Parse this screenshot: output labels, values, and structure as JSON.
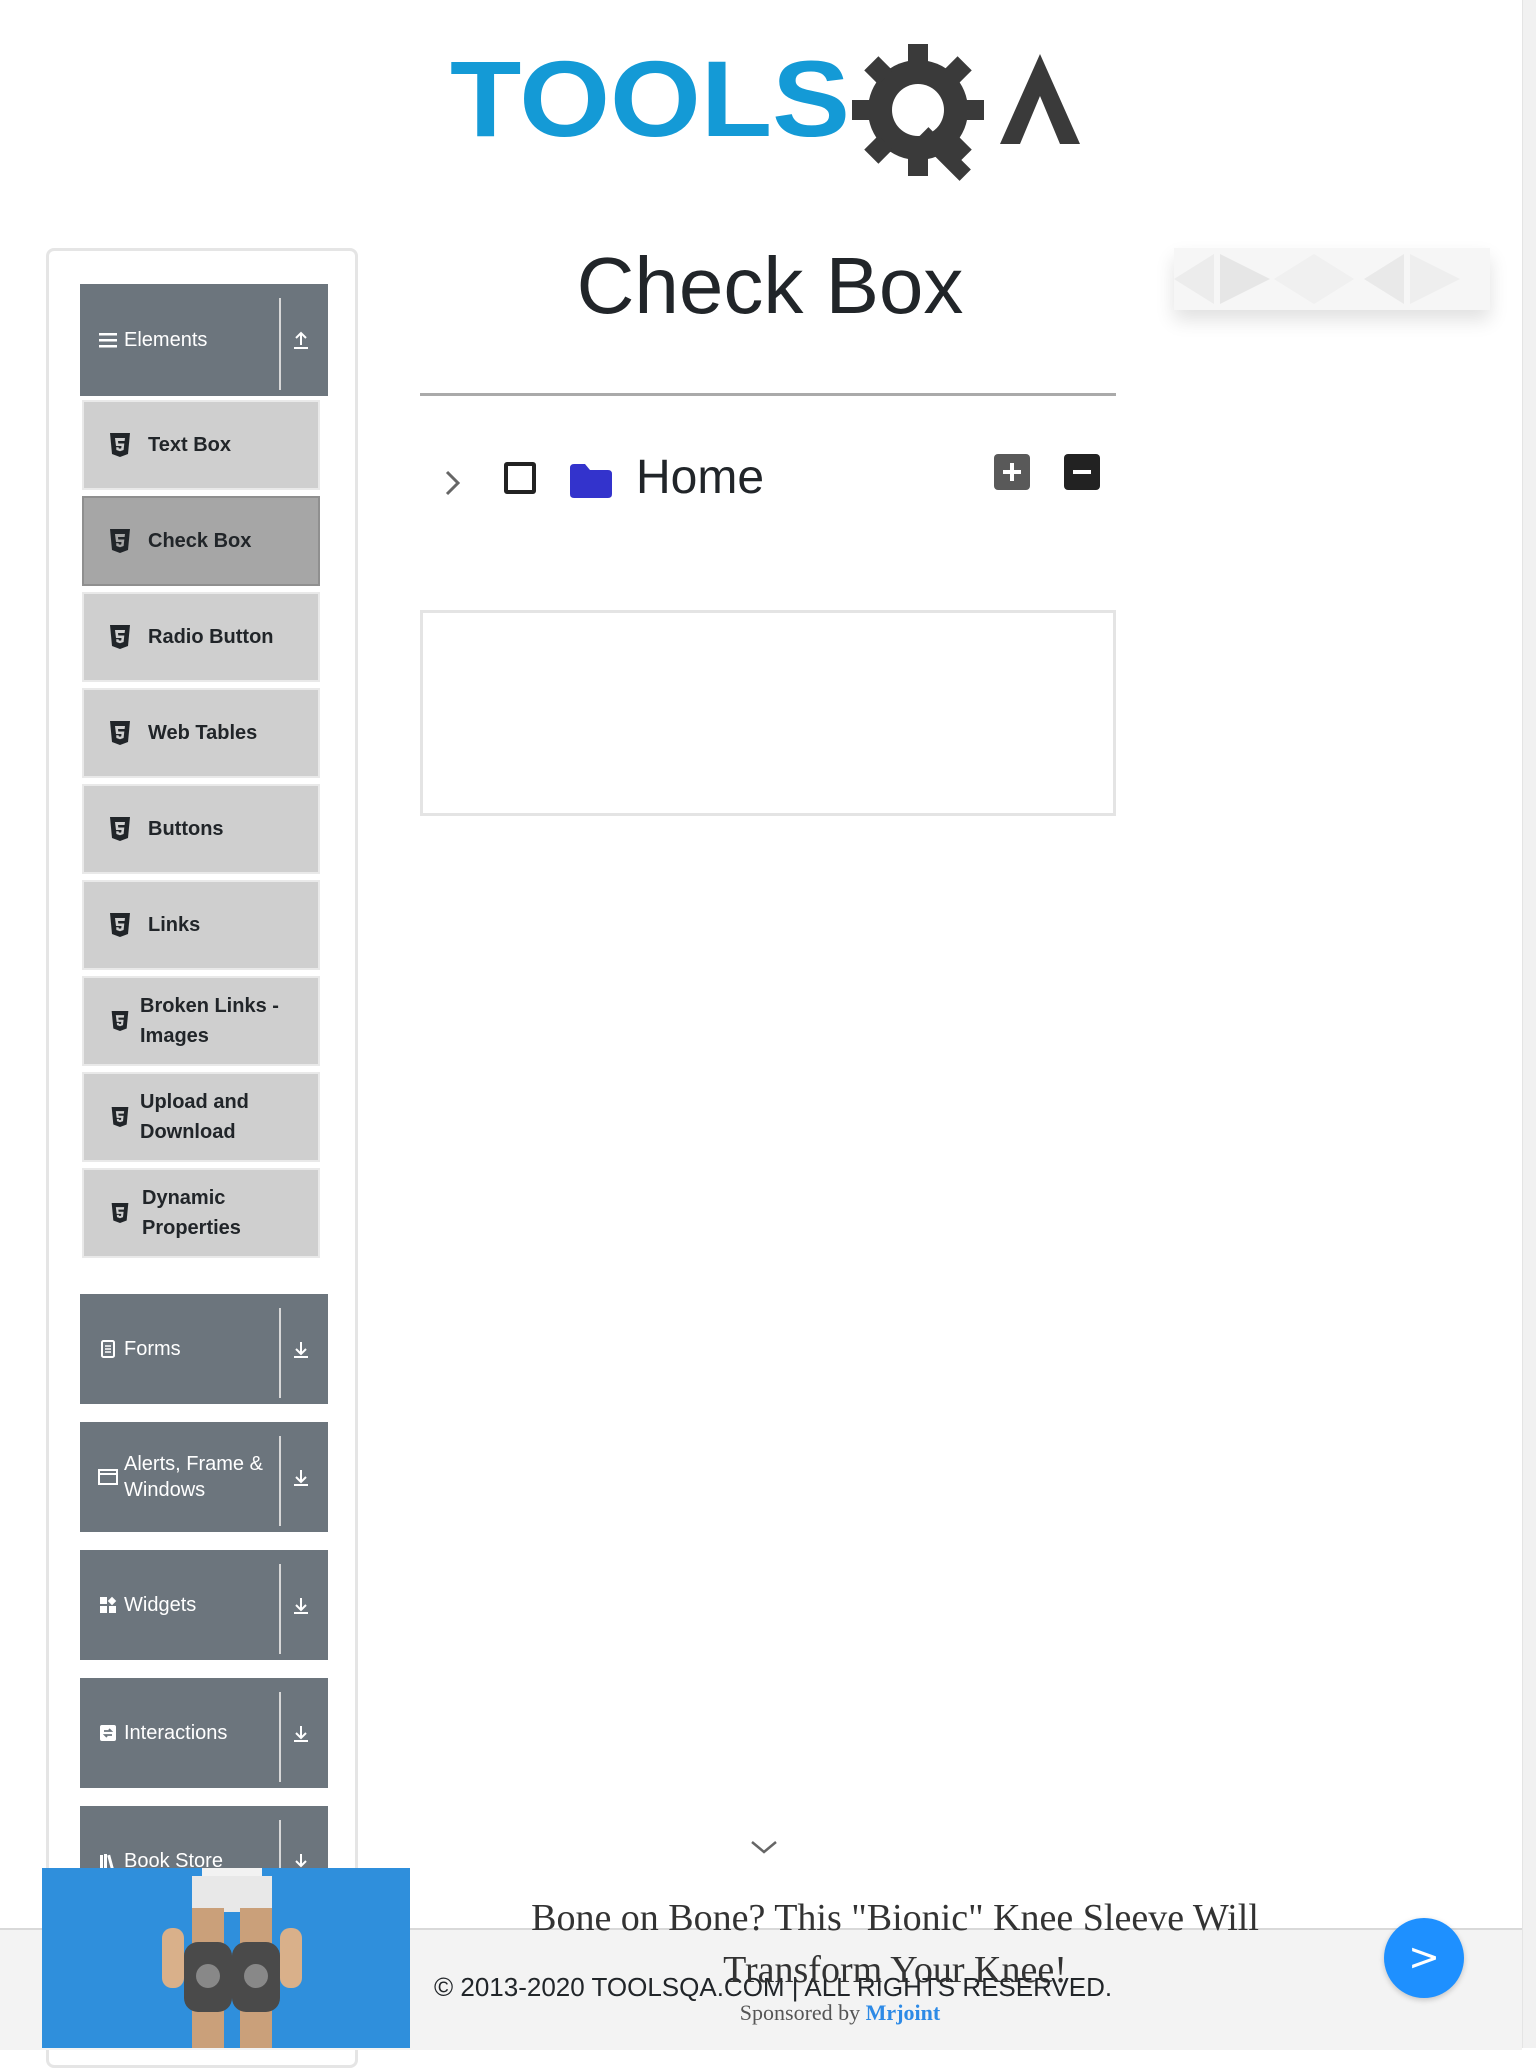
{
  "logo": {
    "text_part": "TOOLS",
    "qa_part": "QA",
    "brand_blue": "#149ad6",
    "brand_dark": "#3a3a3a"
  },
  "sidebar": {
    "groups": [
      {
        "label": "Elements",
        "icon": "hamburger-icon",
        "arrow": "up-arrow-icon",
        "expanded": true
      },
      {
        "label": "Forms",
        "icon": "document-icon",
        "arrow": "down-arrow-icon",
        "expanded": false
      },
      {
        "label": "Alerts, Frame & Windows",
        "icon": "window-icon",
        "arrow": "down-arrow-icon",
        "expanded": false
      },
      {
        "label": "Widgets",
        "icon": "widgets-icon",
        "arrow": "down-arrow-icon",
        "expanded": false
      },
      {
        "label": "Interactions",
        "icon": "interactions-icon",
        "arrow": "down-arrow-icon",
        "expanded": false
      },
      {
        "label": "Book Store",
        "icon": "books-icon",
        "arrow": "down-arrow-icon",
        "expanded": false
      }
    ],
    "elements_items": [
      {
        "label": "Text Box",
        "icon": "html5-icon"
      },
      {
        "label": "Check Box",
        "icon": "html5-icon",
        "active": true
      },
      {
        "label": "Radio Button",
        "icon": "html5-icon"
      },
      {
        "label": "Web Tables",
        "icon": "html5-icon"
      },
      {
        "label": "Buttons",
        "icon": "html5-icon"
      },
      {
        "label": "Links",
        "icon": "html5-icon"
      },
      {
        "label": "Broken Links - Images",
        "icon": "html5-icon"
      },
      {
        "label": "Upload and Download",
        "icon": "html5-icon"
      },
      {
        "label": "Dynamic Properties",
        "icon": "html5-icon"
      }
    ]
  },
  "main": {
    "title": "Check Box",
    "tree": {
      "root_label": "Home",
      "checked": false,
      "expanded": false,
      "folder_color": "#3333cc"
    },
    "expand_all_icon": "plus-square-icon",
    "collapse_all_icon": "minus-square-icon"
  },
  "footer": {
    "text": "© 2013-2020 TOOLSQA.COM | ALL RIGHTS RESERVED."
  },
  "ad": {
    "headline": "Bone on Bone? This \"Bionic\" Knee Sleeve Will Transform Your Knee!",
    "sponsor_prefix": "Sponsored by",
    "sponsor_brand": "Mrjoint",
    "next_label": ">",
    "accent": "#1e90ff"
  }
}
